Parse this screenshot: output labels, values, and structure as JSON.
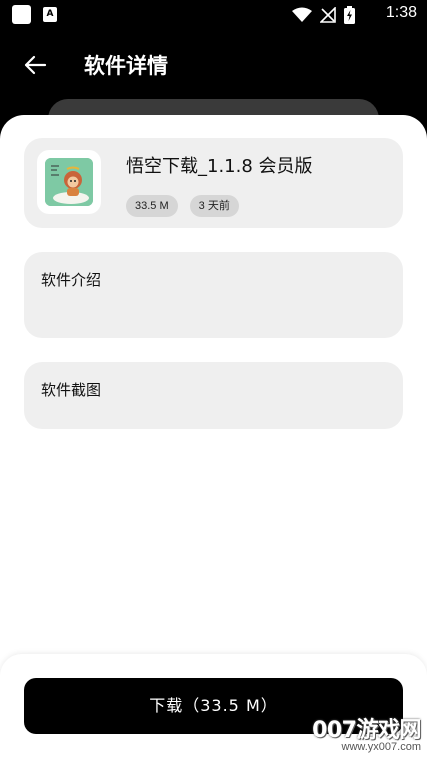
{
  "status_bar": {
    "time": "1:38",
    "notification_icon": "a-notification-icon",
    "icons": [
      "wifi-icon",
      "signal-off-icon",
      "battery-charging-icon"
    ]
  },
  "header": {
    "back_icon": "back-arrow-icon",
    "title": "软件详情"
  },
  "app": {
    "name": "悟空下载_1.1.8 会员版",
    "size": "33.5 M",
    "updated": "3 天前",
    "icon": "wukong-app-icon"
  },
  "sections": {
    "intro_title": "软件介绍",
    "screenshots_title": "软件截图"
  },
  "download": {
    "label": "下载（33.5 M）"
  },
  "watermark": {
    "name": "007游戏网",
    "url": "www.yx007.com"
  },
  "colors": {
    "background": "#000000",
    "card": "#efefef",
    "chip": "#d6d6d6",
    "button": "#000000",
    "icon_bg": "#7ec9a4"
  }
}
